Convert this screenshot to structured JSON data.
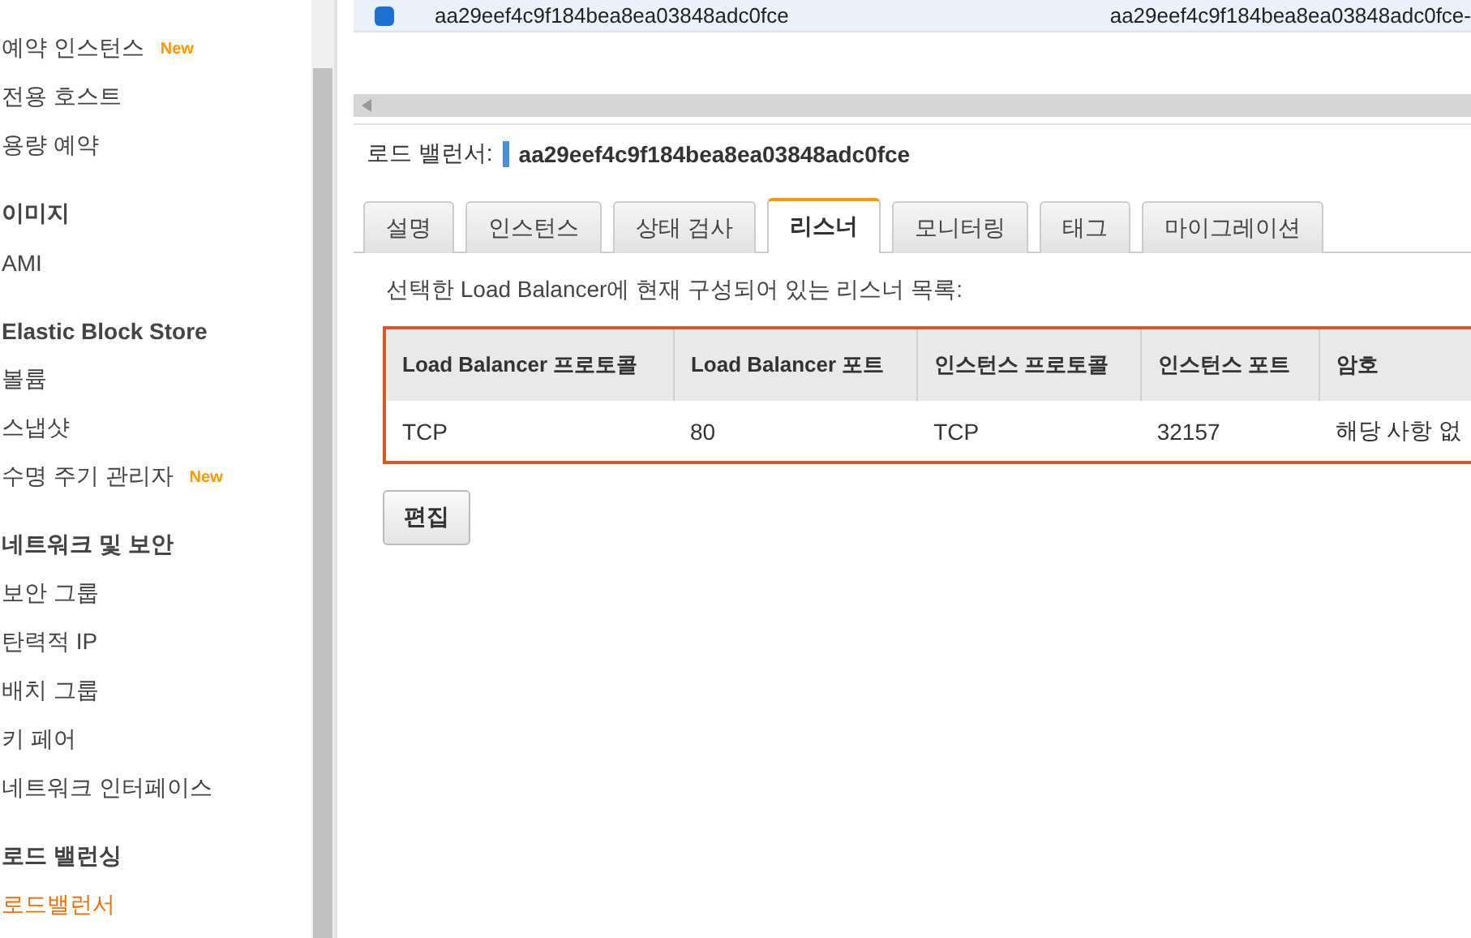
{
  "sidebar": {
    "items": [
      {
        "kind": "link",
        "label": "예약 인스턴스",
        "badge": "New",
        "selected": false
      },
      {
        "kind": "link",
        "label": "전용 호스트",
        "selected": false
      },
      {
        "kind": "link",
        "label": "용량 예약",
        "selected": false
      },
      {
        "kind": "heading",
        "label": "이미지"
      },
      {
        "kind": "link",
        "label": "AMI",
        "selected": false
      },
      {
        "kind": "heading",
        "label": "Elastic Block Store"
      },
      {
        "kind": "link",
        "label": "볼륨",
        "selected": false
      },
      {
        "kind": "link",
        "label": "스냅샷",
        "selected": false
      },
      {
        "kind": "link",
        "label": "수명 주기 관리자",
        "badge": "New",
        "selected": false
      },
      {
        "kind": "heading",
        "label": "네트워크 및 보안"
      },
      {
        "kind": "link",
        "label": "보안 그룹",
        "selected": false
      },
      {
        "kind": "link",
        "label": "탄력적 IP",
        "selected": false
      },
      {
        "kind": "link",
        "label": "배치 그룹",
        "selected": false
      },
      {
        "kind": "link",
        "label": "키 페어",
        "selected": false
      },
      {
        "kind": "link",
        "label": "네트워크 인터페이스",
        "selected": false
      },
      {
        "kind": "heading",
        "label": "로드 밸런싱"
      },
      {
        "kind": "link",
        "label": "로드밸런서",
        "selected": true
      }
    ]
  },
  "list": {
    "rows": [
      {
        "selected": true,
        "cells": [
          "aa29eef4c9f184bea8ea03848adc0fce",
          "aa29eef4c9f184bea8ea03848adc0fce-"
        ]
      }
    ]
  },
  "details": {
    "label": "로드 밸런서:",
    "name": "aa29eef4c9f184bea8ea03848adc0fce",
    "tabs": [
      {
        "label": "설명",
        "selected": false
      },
      {
        "label": "인스턴스",
        "selected": false
      },
      {
        "label": "상태 검사",
        "selected": false
      },
      {
        "label": "리스너",
        "selected": true
      },
      {
        "label": "모니터링",
        "selected": false
      },
      {
        "label": "태그",
        "selected": false
      },
      {
        "label": "마이그레이션",
        "selected": false
      }
    ],
    "description": "선택한 Load Balancer에 현재 구성되어 있는 리스너 목록:",
    "table": {
      "columns": [
        "Load Balancer 프로토콜",
        "Load Balancer 포트",
        "인스턴스 프로토콜",
        "인스턴스 포트",
        "암호"
      ],
      "rows": [
        [
          "TCP",
          "80",
          "TCP",
          "32157",
          "해당 사항 없"
        ]
      ]
    },
    "edit_button": "편집"
  }
}
